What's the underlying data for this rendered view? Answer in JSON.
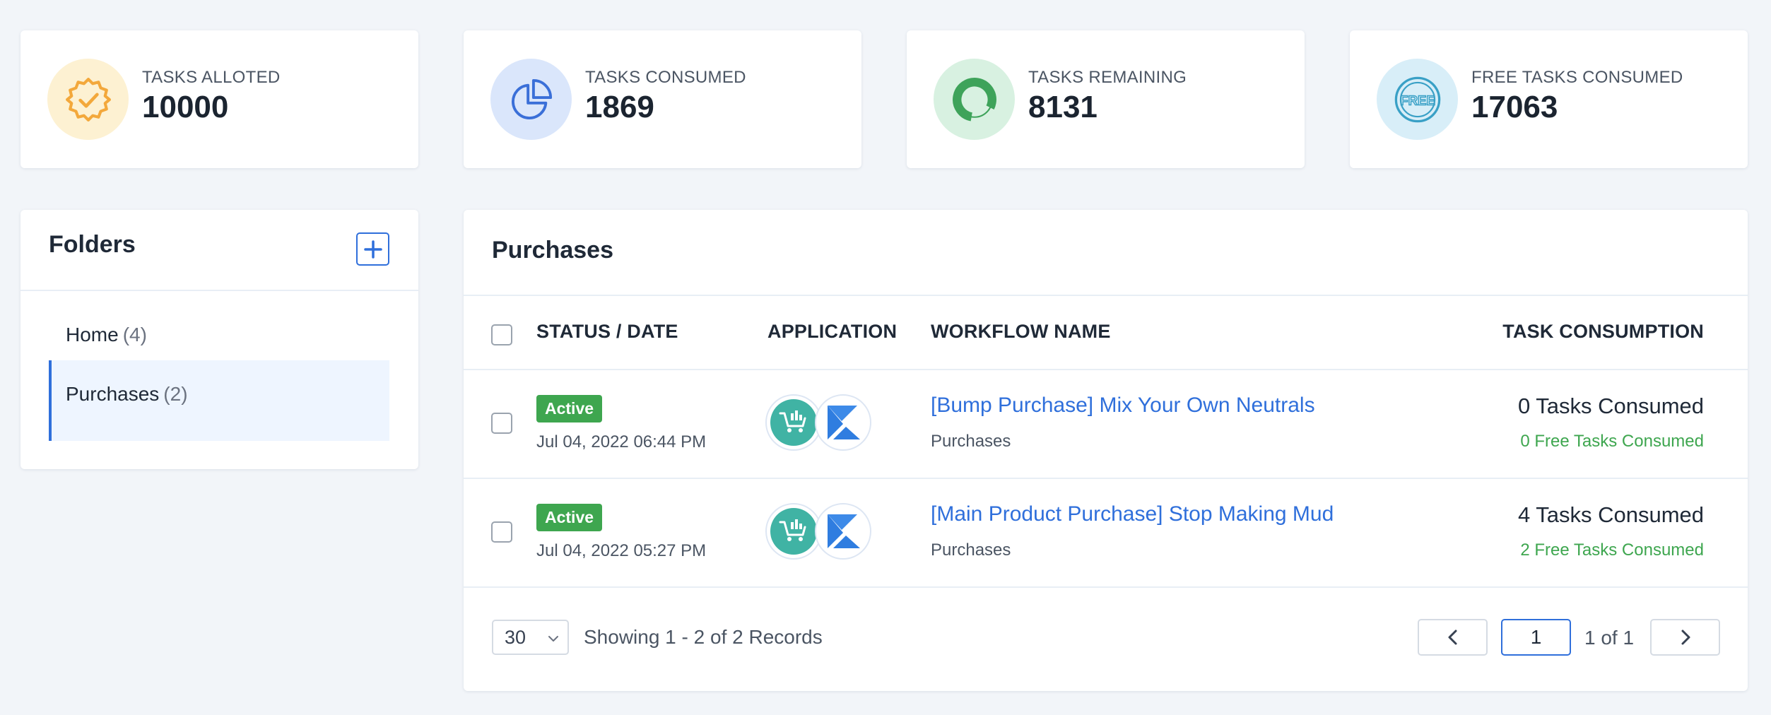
{
  "stats": [
    {
      "label": "TASKS ALLOTED",
      "value": "10000",
      "icon": "badge-check-icon",
      "bg": "#fdf1d2",
      "fg": "#f3a83b"
    },
    {
      "label": "TASKS CONSUMED",
      "value": "1869",
      "icon": "pie-chart-icon",
      "bg": "#dae6fb",
      "fg": "#3a6fd8"
    },
    {
      "label": "TASKS REMAINING",
      "value": "8131",
      "icon": "donut-chart-icon",
      "bg": "#d8f1e1",
      "fg": "#3ea35a"
    },
    {
      "label": "FREE TASKS CONSUMED",
      "value": "17063",
      "icon": "free-stamp-icon",
      "bg": "#d8eef8",
      "fg": "#39a0c6",
      "icon_text": "FREE"
    }
  ],
  "folders": {
    "title": "Folders",
    "items": [
      {
        "name": "Home",
        "count": "(4)"
      },
      {
        "name": "Purchases",
        "count": "(2)"
      }
    ]
  },
  "panel": {
    "title": "Purchases",
    "columns": {
      "status_date": "STATUS / DATE",
      "application": "APPLICATION",
      "workflow_name": "WORKFLOW NAME",
      "task_consumption": "TASK CONSUMPTION"
    },
    "rows": [
      {
        "status": "Active",
        "date": "Jul 04, 2022 06:44 PM",
        "apps": [
          "shopping-cart-chart-icon",
          "kartra-k-icon"
        ],
        "workflow": "[Bump Purchase] Mix Your Own Neutrals",
        "folder": "Purchases",
        "tasks": "0 Tasks Consumed",
        "free_tasks": "0 Free Tasks Consumed"
      },
      {
        "status": "Active",
        "date": "Jul 04, 2022 05:27 PM",
        "apps": [
          "shopping-cart-chart-icon",
          "kartra-k-icon"
        ],
        "workflow": "[Main Product Purchase] Stop Making Mud",
        "folder": "Purchases",
        "tasks": "4 Tasks Consumed",
        "free_tasks": "2 Free Tasks Consumed"
      }
    ],
    "footer": {
      "page_size": "30",
      "showing": "Showing 1 - 2 of 2 Records",
      "current_page": "1",
      "page_of": "1 of 1"
    }
  },
  "colors": {
    "accent": "#2f6fdb",
    "active_badge": "#3ea64f",
    "free_text": "#3ea64f"
  }
}
